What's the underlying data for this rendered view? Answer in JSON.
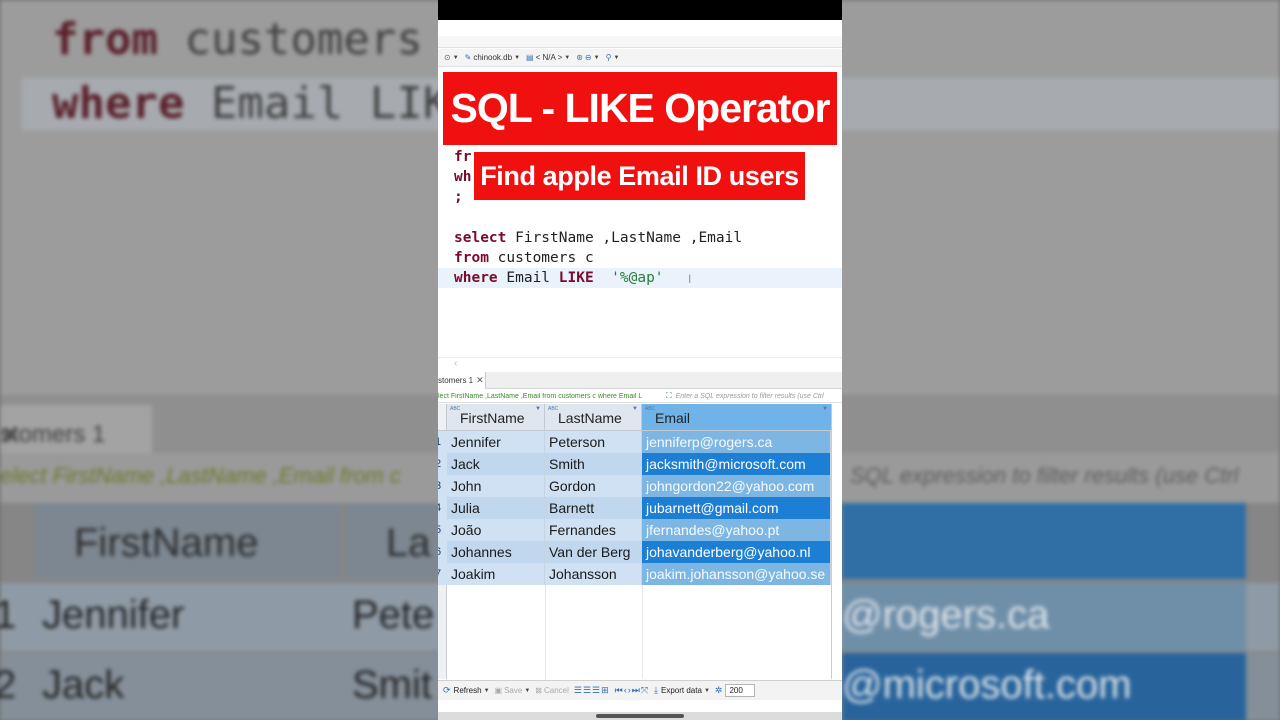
{
  "background": {
    "code_lines": [
      {
        "kw": "from",
        "rest": " customers c"
      },
      {
        "kw": "where",
        "rest": " Email LIKE"
      }
    ],
    "tab_label": "stomers 1",
    "tab_close": "✕",
    "filter_query": "elect FirstName ,LastName ,Email from c",
    "filter_placeholder": "SQL expression to filter results (use Ctrl",
    "headers": [
      "FirstName",
      "La"
    ],
    "rows": [
      {
        "num": "1",
        "first": "Jennifer",
        "last": "Pete",
        "email": "@rogers.ca"
      },
      {
        "num": "2",
        "first": "Jack",
        "last": "Smit",
        "email": "@microsoft.com"
      }
    ]
  },
  "toolbar": {
    "database": "chinook.db",
    "schema": "< N/A >"
  },
  "overlay": {
    "title": "SQL - LIKE Operator",
    "subtitle": "Find apple Email ID users"
  },
  "editor": {
    "prev_lines": [
      "fr",
      "wh",
      ";"
    ],
    "select_kw": "select",
    "select_rest": " FirstName ,LastName ,Email",
    "from_kw": "from",
    "from_rest": " customers c",
    "where_kw": "where",
    "where_mid": " Email ",
    "like_kw": "LIKE",
    "like_str": "'%@ap'"
  },
  "results": {
    "tab_label": "stomers 1",
    "tab_close": "✕",
    "filter_query": "lect FirstName ,LastName ,Email from customers c where Email L",
    "filter_placeholder": "Enter a SQL expression to filter results (use Ctrl",
    "columns": [
      "FirstName",
      "LastName",
      "Email"
    ],
    "rows": [
      {
        "num": "1",
        "first": "Jennifer",
        "last": "Peterson",
        "email": "jenniferp@rogers.ca"
      },
      {
        "num": "2",
        "first": "Jack",
        "last": "Smith",
        "email": "jacksmith@microsoft.com"
      },
      {
        "num": "3",
        "first": "John",
        "last": "Gordon",
        "email": "johngordon22@yahoo.com"
      },
      {
        "num": "4",
        "first": "Julia",
        "last": "Barnett",
        "email": "jubarnett@gmail.com"
      },
      {
        "num": "5",
        "first": "João",
        "last": "Fernandes",
        "email": "jfernandes@yahoo.pt"
      },
      {
        "num": "6",
        "first": "Johannes",
        "last": "Van der Berg",
        "email": "johavanderberg@yahoo.nl"
      },
      {
        "num": "7",
        "first": "Joakim",
        "last": "Johansson",
        "email": "joakim.johansson@yahoo.se"
      }
    ]
  },
  "bottombar": {
    "refresh": "Refresh",
    "save": "Save",
    "cancel": "Cancel",
    "export": "Export data",
    "limit": "200"
  },
  "colors": {
    "banner": "#f01010",
    "keyword": "#7b0a2b",
    "string": "#2b7d3b",
    "selected_cell": "#1d7fd3"
  }
}
